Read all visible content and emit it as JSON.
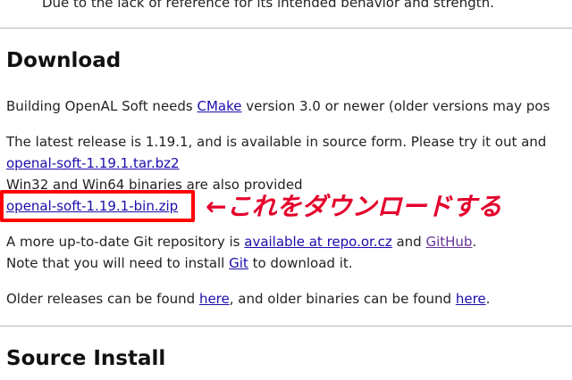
{
  "top_partial_text": "Due to the lack of reference for its intended behavior and strength.",
  "download": {
    "heading": "Download",
    "build_pre": "Building OpenAL Soft needs ",
    "cmake_link": "CMake",
    "build_post": " version 3.0 or newer (older versions may pos",
    "latest_text": "The latest release is 1.19.1, and is available in source form. Please try it out and",
    "tarball_link": "openal-soft-1.19.1.tar.bz2",
    "binaries_text": "Win32 and Win64 binaries are also provided",
    "zip_link": "openal-soft-1.19.1-bin.zip",
    "annotation": "←これをダウンロードする",
    "git_pre": "A more up-to-date Git repository is ",
    "git_repo_link": "available at repo.or.cz",
    "git_and": " and ",
    "github_link": "GitHub",
    "git_post": ".",
    "note_pre": "Note that you will need to install ",
    "git_install_link": "Git",
    "note_post": " to download it.",
    "older_pre": "Older releases can be found ",
    "older_here_link": "here",
    "older_mid": ", and older binaries can be found ",
    "older_binaries_link": "here",
    "older_post": "."
  },
  "source_install": {
    "heading": "Source Install"
  },
  "colors": {
    "link": "#1a0dab",
    "visited_link": "#663399",
    "highlight": "#ff0000",
    "annotation": "#e4002b"
  }
}
